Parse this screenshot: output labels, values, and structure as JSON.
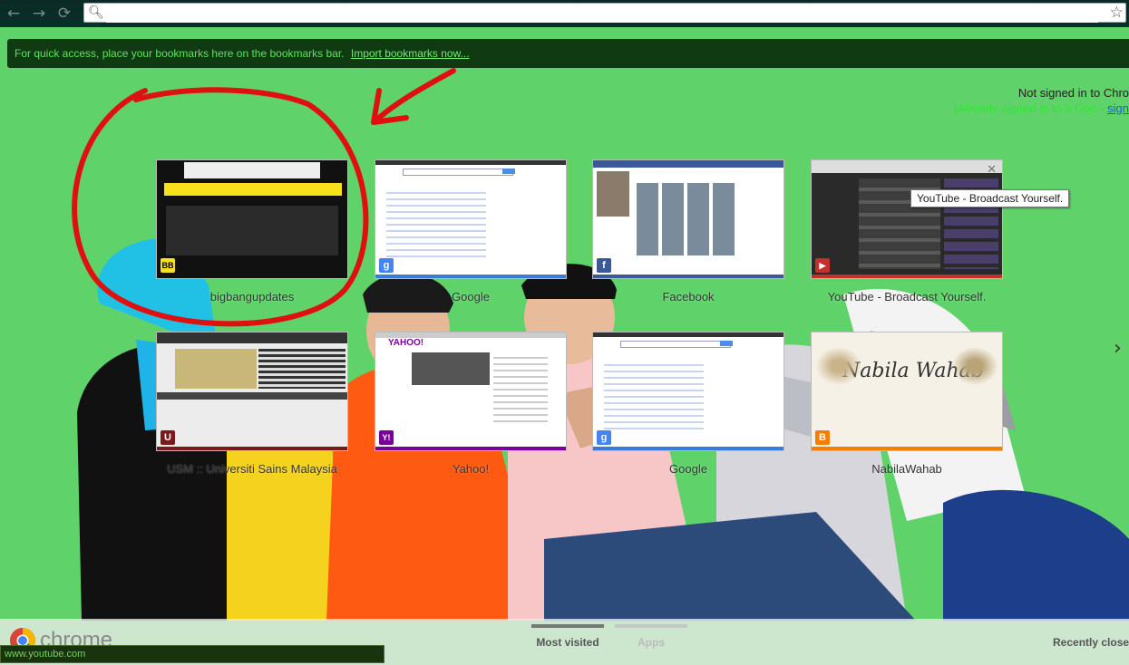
{
  "toolbar": {
    "back_icon": "back-arrow-icon",
    "forward_icon": "forward-arrow-icon",
    "reload_icon": "reload-icon",
    "omnibox_value": "",
    "search_icon": "magnifier-icon",
    "star_icon": "bookmark-star-icon"
  },
  "bookmarks_bar": {
    "message": "For quick access, place your bookmarks here on the bookmarks bar.",
    "import_link": "Import bookmarks now..."
  },
  "sign_in": {
    "status": "Not signed in to Chro",
    "prompt": "(Already signed in to a Goo",
    "link": "sign"
  },
  "most_visited": [
    {
      "title": "bigbangupdates",
      "favicon": "BB",
      "accent": "#f7e11b"
    },
    {
      "title": "Google",
      "favicon": "g",
      "accent": "#3a7bd5"
    },
    {
      "title": "Facebook",
      "favicon": "f",
      "accent": "#3b5998"
    },
    {
      "title": "YouTube - Broadcast Yourself.",
      "favicon": "▶",
      "accent": "#c4302b"
    },
    {
      "title": "USM :: Universiti Sains Malaysia",
      "favicon": "U",
      "accent": "#7a1a1a"
    },
    {
      "title": "Yahoo!",
      "favicon": "Y!",
      "accent": "#7b0099"
    },
    {
      "title": "Google",
      "favicon": "g",
      "accent": "#3a7bd5"
    },
    {
      "title": "NabilaWahab",
      "favicon": "B",
      "accent": "#f57d00"
    }
  ],
  "tooltip": "YouTube - Broadcast Yourself.",
  "bottom": {
    "brand": "chrome",
    "tab_most_visited": "Most visited",
    "tab_apps": "Apps",
    "recently_closed": "Recently closed"
  },
  "status_url": "www.youtube.com",
  "colors": {
    "page_bg": "#5fd36a",
    "annotation": "#e01010"
  }
}
